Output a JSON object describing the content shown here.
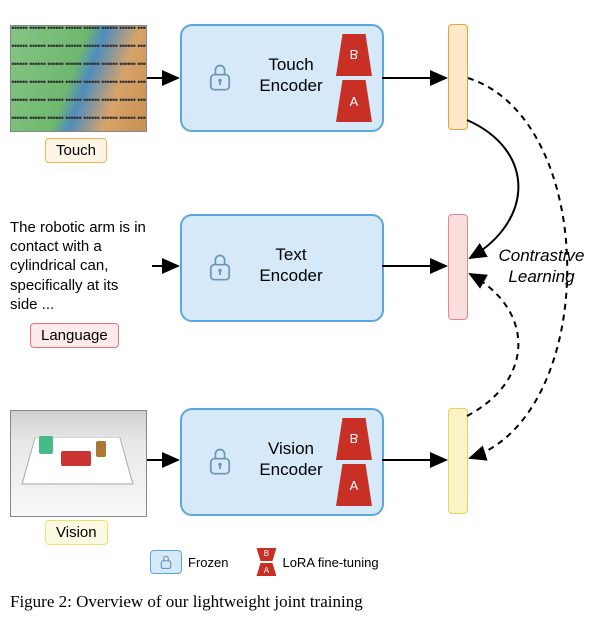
{
  "modalities": {
    "touch": {
      "label": "Touch",
      "encoder_label": "Touch\nEncoder"
    },
    "language": {
      "label": "Language",
      "encoder_label": "Text\nEncoder",
      "sample_text": "The robotic arm is in contact with a cylindrical can, specifically at its side ..."
    },
    "vision": {
      "label": "Vision",
      "encoder_label": "Vision\nEncoder"
    }
  },
  "lora": {
    "B": "B",
    "A": "A"
  },
  "contrastive_label": "Contrastive Learning",
  "legend": {
    "frozen": "Frozen",
    "lora": "LoRA fine-tuning"
  },
  "caption_prefix": "Figure 2:",
  "caption_rest": "Overview of our lightweight joint training",
  "chart_data": {
    "type": "diagram",
    "title": "Overview of lightweight joint training",
    "nodes": [
      {
        "id": "touch_input",
        "kind": "image",
        "modality": "Touch"
      },
      {
        "id": "touch_encoder",
        "kind": "encoder",
        "label": "Touch Encoder",
        "frozen": true,
        "lora": true
      },
      {
        "id": "touch_embed",
        "kind": "embedding",
        "color": "orange"
      },
      {
        "id": "text_input",
        "kind": "text",
        "modality": "Language",
        "content": "The robotic arm is in contact with a cylindrical can, specifically at its side ..."
      },
      {
        "id": "text_encoder",
        "kind": "encoder",
        "label": "Text Encoder",
        "frozen": true,
        "lora": false
      },
      {
        "id": "text_embed",
        "kind": "embedding",
        "color": "red"
      },
      {
        "id": "vision_input",
        "kind": "image",
        "modality": "Vision"
      },
      {
        "id": "vision_encoder",
        "kind": "encoder",
        "label": "Vision Encoder",
        "frozen": true,
        "lora": true
      },
      {
        "id": "vision_embed",
        "kind": "embedding",
        "color": "yellow"
      }
    ],
    "edges": [
      {
        "from": "touch_input",
        "to": "touch_encoder",
        "style": "solid"
      },
      {
        "from": "touch_encoder",
        "to": "touch_embed",
        "style": "solid"
      },
      {
        "from": "text_input",
        "to": "text_encoder",
        "style": "solid"
      },
      {
        "from": "text_encoder",
        "to": "text_embed",
        "style": "solid"
      },
      {
        "from": "vision_input",
        "to": "vision_encoder",
        "style": "solid"
      },
      {
        "from": "vision_encoder",
        "to": "vision_embed",
        "style": "solid"
      },
      {
        "from": "touch_embed",
        "to": "text_embed",
        "style": "solid",
        "label": "Contrastive Learning"
      },
      {
        "from": "vision_embed",
        "to": "text_embed",
        "style": "dashed",
        "label": "Contrastive Learning"
      },
      {
        "from": "touch_embed",
        "to": "vision_embed",
        "style": "dashed",
        "label": "Contrastive Learning"
      }
    ],
    "legend": [
      {
        "symbol": "lock-box",
        "meaning": "Frozen"
      },
      {
        "symbol": "lora-trapezoids",
        "meaning": "LoRA fine-tuning"
      }
    ]
  }
}
